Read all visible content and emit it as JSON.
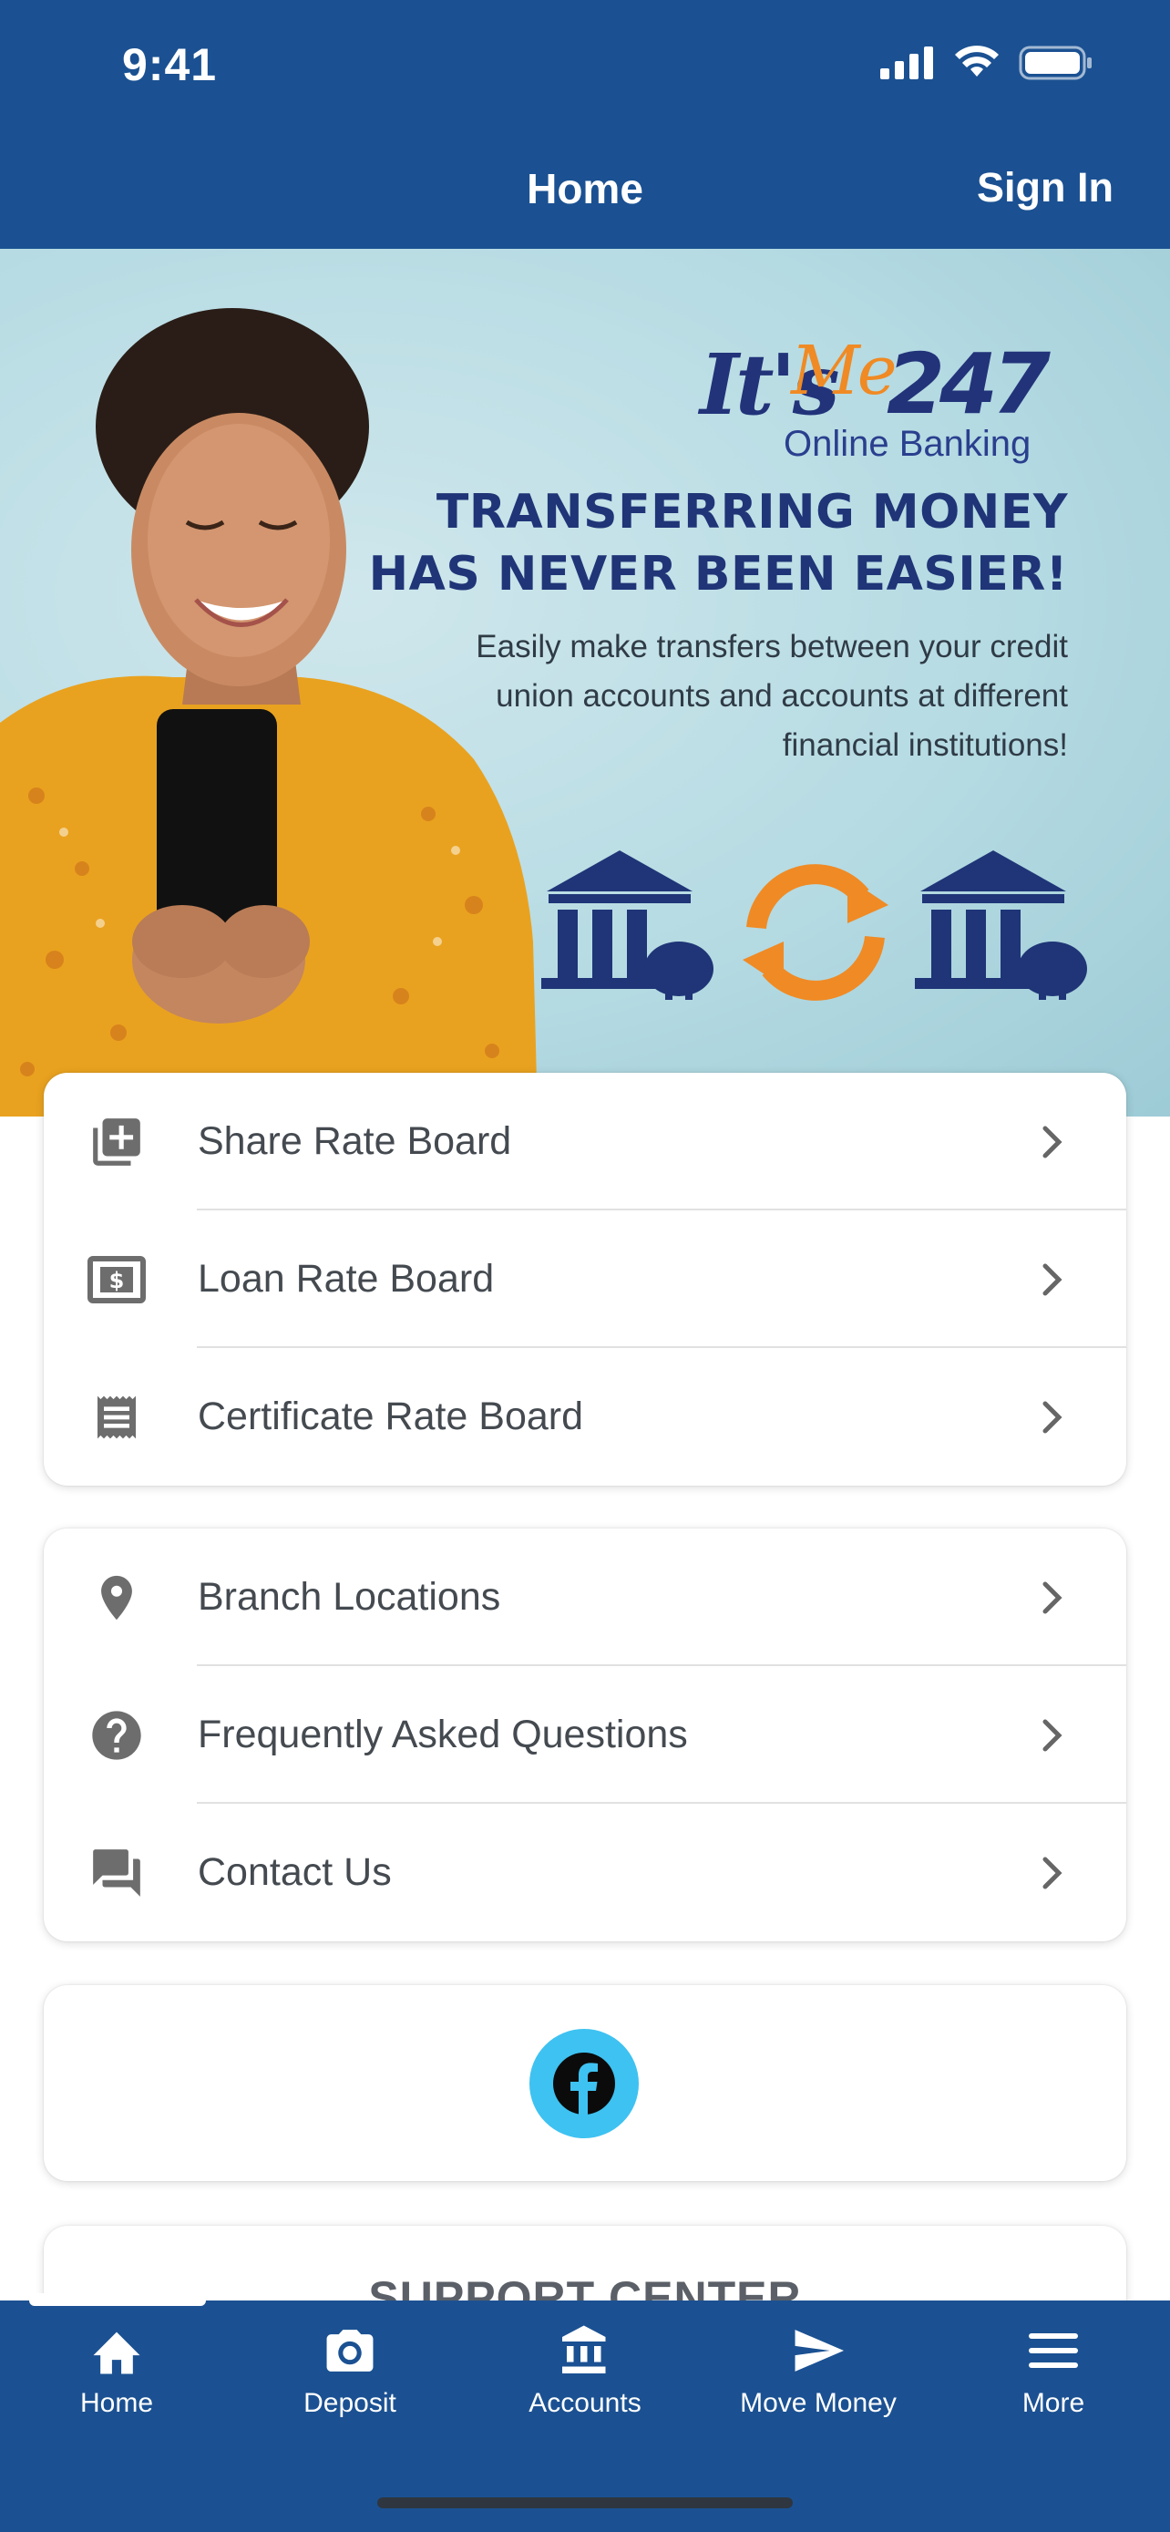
{
  "status_bar": {
    "time": "9:41",
    "icons": [
      "signal-icon",
      "wifi-icon",
      "battery-icon"
    ]
  },
  "header": {
    "title": "Home",
    "sign_in": "Sign In"
  },
  "banner": {
    "logo_its": "It's",
    "logo_me": "Me",
    "logo_num": "247",
    "logo_sub": "Online Banking",
    "headline_line1": "TRANSFERRING MONEY",
    "headline_line2": "HAS NEVER BEEN EASIER!",
    "subtext": "Easily make transfers between your credit union accounts and accounts at different financial institutions!"
  },
  "rate_boards": [
    {
      "label": "Share Rate Board",
      "icon": "add-box-stack-icon"
    },
    {
      "label": "Loan Rate Board",
      "icon": "dollar-bill-icon"
    },
    {
      "label": "Certificate Rate Board",
      "icon": "receipt-icon"
    }
  ],
  "info_links": [
    {
      "label": "Branch Locations",
      "icon": "location-pin-icon"
    },
    {
      "label": "Frequently Asked Questions",
      "icon": "help-circle-icon"
    },
    {
      "label": "Contact Us",
      "icon": "chat-bubbles-icon"
    }
  ],
  "social": {
    "icon": "facebook-icon"
  },
  "support": {
    "title": "SUPPORT CENTER"
  },
  "tabbar": [
    {
      "label": "Home",
      "icon": "home-icon"
    },
    {
      "label": "Deposit",
      "icon": "camera-icon"
    },
    {
      "label": "Accounts",
      "icon": "bank-icon"
    },
    {
      "label": "Move Money",
      "icon": "send-icon"
    },
    {
      "label": "More",
      "icon": "menu-icon"
    }
  ],
  "colors": {
    "brand_blue": "#1b5192",
    "accent_orange": "#f08a24",
    "facebook_blue": "#3ec2f1"
  }
}
